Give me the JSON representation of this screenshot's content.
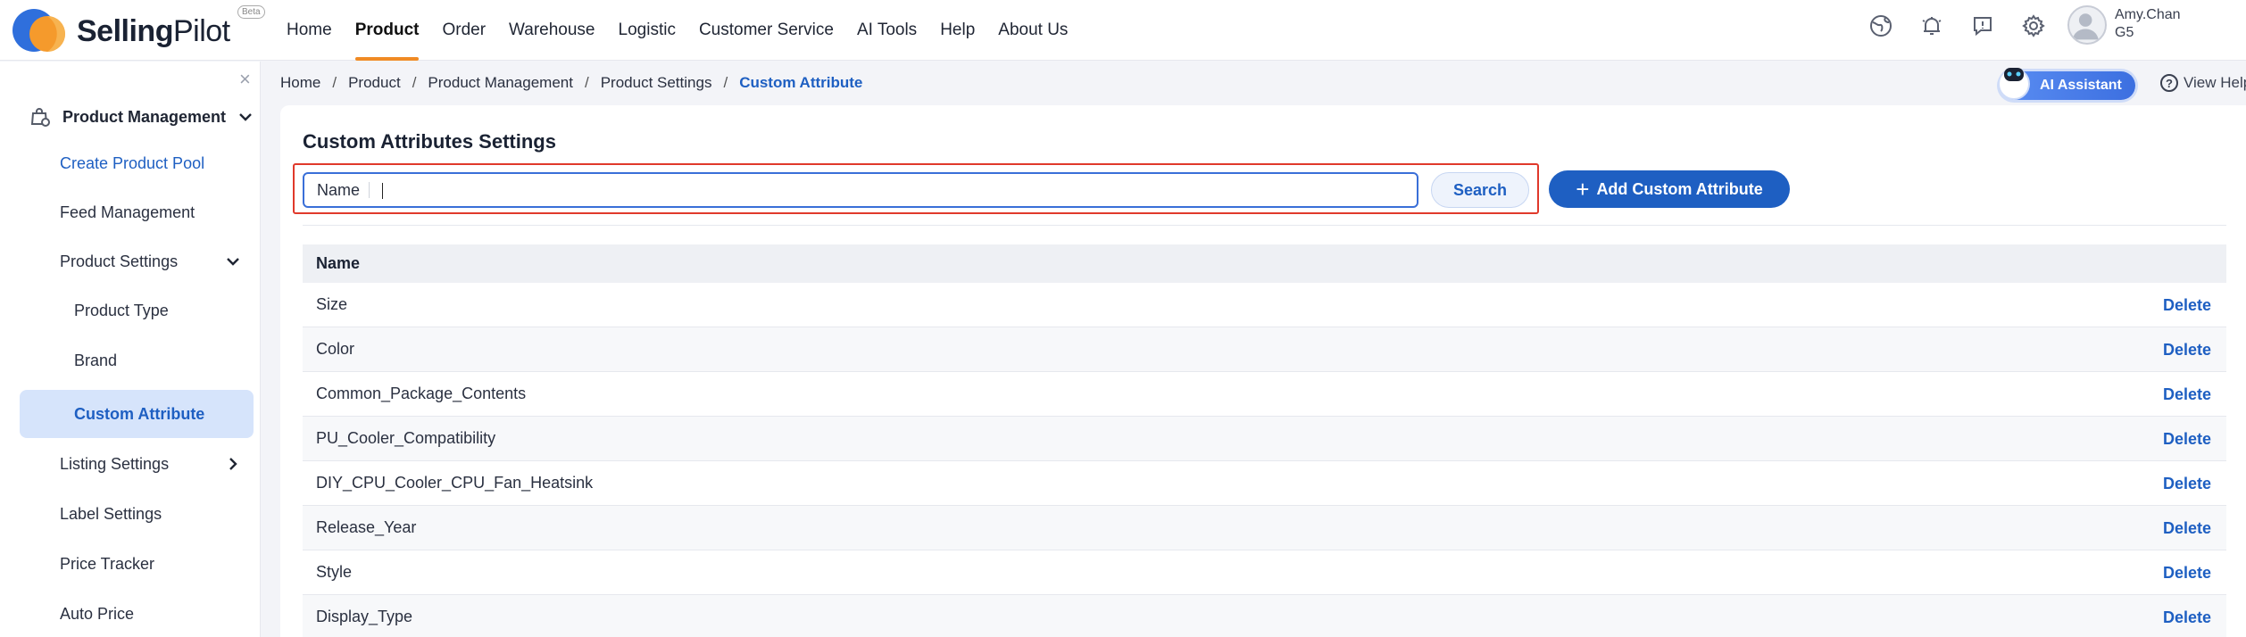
{
  "brand": {
    "name_bold": "Selling",
    "name_regular": "Pilot",
    "badge": "Beta"
  },
  "nav": [
    {
      "label": "Home",
      "active": false
    },
    {
      "label": "Product",
      "active": true
    },
    {
      "label": "Order",
      "active": false
    },
    {
      "label": "Warehouse",
      "active": false
    },
    {
      "label": "Logistic",
      "active": false
    },
    {
      "label": "Customer Service",
      "active": false
    },
    {
      "label": "AI Tools",
      "active": false
    },
    {
      "label": "Help",
      "active": false
    },
    {
      "label": "About Us",
      "active": false
    }
  ],
  "header_icons": [
    "globe-icon",
    "bell-icon",
    "chat-icon",
    "gear-icon"
  ],
  "user": {
    "name": "Amy.Chan",
    "role": "G5"
  },
  "sidebar": {
    "group": {
      "label": "Product Management",
      "icon": "product-management-icon"
    },
    "items": [
      {
        "label": "Create Product Pool"
      },
      {
        "label": "Feed Management"
      },
      {
        "label": "Product Settings"
      },
      {
        "label": "Product Type"
      },
      {
        "label": "Brand"
      },
      {
        "label": "Custom Attribute"
      },
      {
        "label": "Listing Settings"
      },
      {
        "label": "Label Settings"
      },
      {
        "label": "Price Tracker"
      },
      {
        "label": "Auto Price"
      }
    ]
  },
  "breadcrumb": [
    {
      "label": "Home"
    },
    {
      "label": "Product"
    },
    {
      "label": "Product Management"
    },
    {
      "label": "Product Settings"
    },
    {
      "label": "Custom Attribute"
    }
  ],
  "ai_assistant": {
    "label": "AI Assistant"
  },
  "view_help": {
    "label": "View Help"
  },
  "page": {
    "title": "Custom Attributes Settings",
    "search": {
      "label": "Name",
      "value": "",
      "button": "Search"
    },
    "add_button": "Add Custom Attribute",
    "table": {
      "header": "Name",
      "action_label": "Delete",
      "rows": [
        "Size",
        "Color",
        "Common_Package_Contents",
        "PU_Cooler_Compatibility",
        "DIY_CPU_Cooler_CPU_Fan_Heatsink",
        "Release_Year",
        "Style",
        "Display_Type"
      ]
    }
  },
  "colors": {
    "primary": "#1e5fc2",
    "accent": "#f08a24",
    "highlight": "#e0392b",
    "active_bg": "#d6e4fb"
  }
}
